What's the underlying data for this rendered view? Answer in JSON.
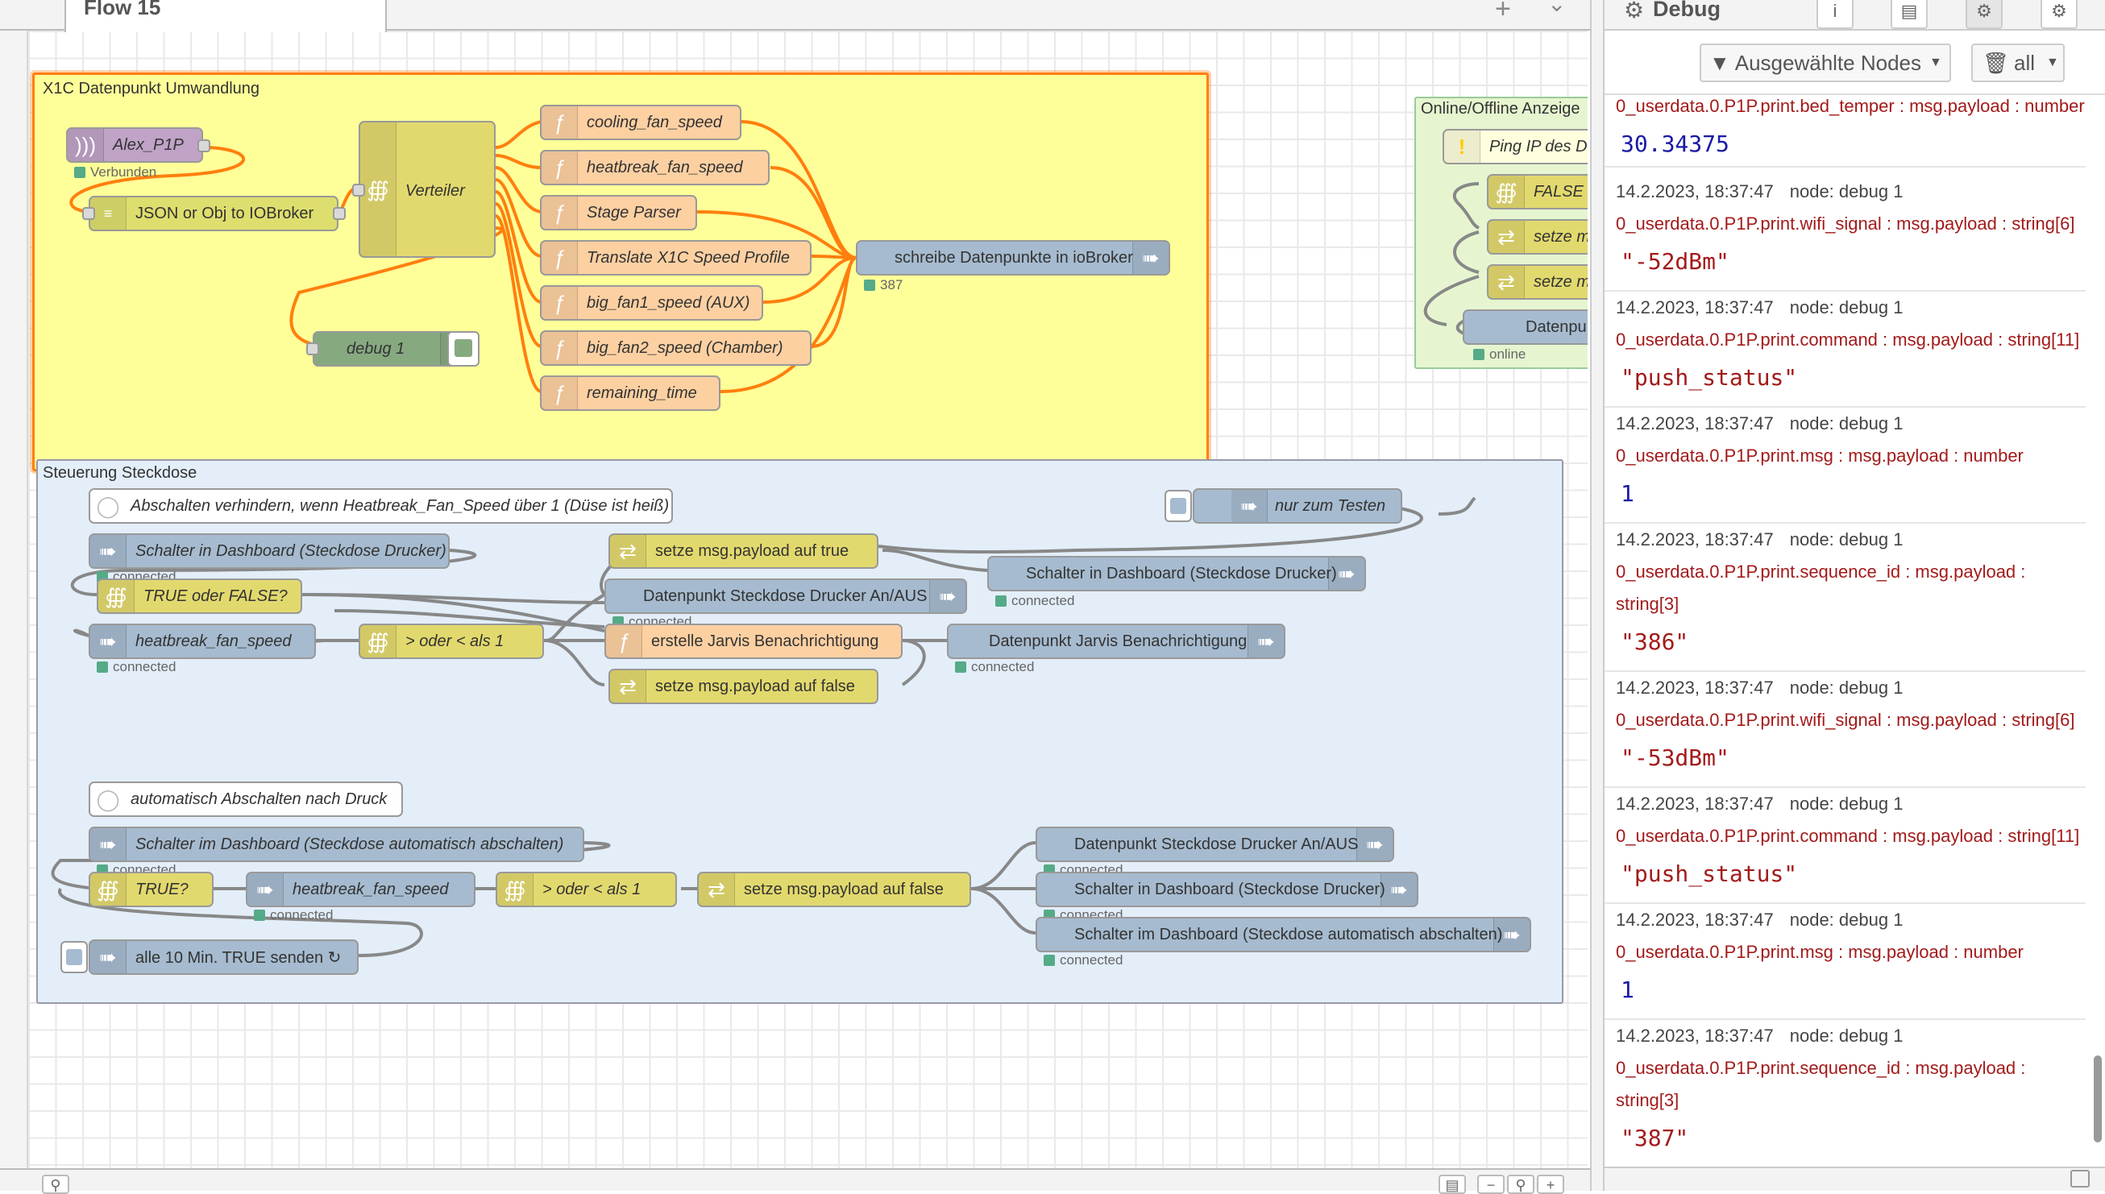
{
  "workspace": {
    "flow_tab": "Flow 15",
    "add_icon": "plus-icon",
    "menu_icon": "chevron-down-icon"
  },
  "colors": {
    "function": "#fdd0a2",
    "switch": "#e2d96e",
    "iobroker": "#a6bbcf",
    "debug": "#87a980",
    "mqtt": "#c0a3c7",
    "group_x1c": "#ffff99",
    "group_steuerung": "#e3f3ff",
    "group_online": "#e6f5d0",
    "wire_selected": "#ff7f0e",
    "status_connected": "#5a8"
  },
  "groups": {
    "x1c": "X1C Datenpunkt Umwandlung",
    "steuerung": "Steuerung Steckdose",
    "online": "Online/Offline Anzeige"
  },
  "nodes": {
    "alex": {
      "label": "Alex_P1P",
      "status": "Verbunden"
    },
    "json": {
      "label": "JSON or Obj to IOBroker"
    },
    "verteiler": {
      "label": "Verteiler"
    },
    "debug1": {
      "label": "debug 1"
    },
    "f1": {
      "label": "cooling_fan_speed"
    },
    "f2": {
      "label": "heatbreak_fan_speed"
    },
    "f3": {
      "label": "Stage Parser"
    },
    "f4": {
      "label": "Translate X1C Speed Profile"
    },
    "f5": {
      "label": "big_fan1_speed (AUX)"
    },
    "f6": {
      "label": "big_fan2_speed (Chamber)"
    },
    "f7": {
      "label": "remaining_time"
    },
    "schreibe": {
      "label": "schreibe Datenpunkte in ioBroker",
      "status": "387"
    },
    "ping": {
      "label": "Ping IP des Dr"
    },
    "false_sw": {
      "label": "FALSE o"
    },
    "setze1": {
      "label": "setze m"
    },
    "setze2": {
      "label": "setze m"
    },
    "dpw": {
      "label": "Datenpunkt W",
      "status": "online"
    },
    "cmt1": {
      "label": "Abschalten verhindern, wenn Heatbreak_Fan_Speed über 1 (Düse ist heiß)"
    },
    "inject_test": {
      "label": "nur zum Testen"
    },
    "schalter_in": {
      "label": "Schalter in Dashboard (Steckdose Drucker)",
      "status": "connected"
    },
    "true_false": {
      "label": "TRUE oder FALSE?"
    },
    "setze_true": {
      "label": "setze msg.payload auf true"
    },
    "schalter_out": {
      "label": "Schalter in Dashboard (Steckdose Drucker)",
      "status": "connected"
    },
    "dp_steck": {
      "label": "Datenpunkt Steckdose Drucker An/AUS",
      "status": "connected"
    },
    "hb_in": {
      "label": "heatbreak_fan_speed",
      "status": "connected"
    },
    "groesser": {
      "label": "> oder < als 1"
    },
    "jarvis_f": {
      "label": "erstelle Jarvis Benachrichtigung"
    },
    "jarvis_out": {
      "label": "Datenpunkt Jarvis Benachrichtigung",
      "status": "connected"
    },
    "setze_false": {
      "label": "setze msg.payload auf false"
    },
    "cmt2": {
      "label": "automatisch Abschalten nach Druck"
    },
    "auto_in": {
      "label": "Schalter im Dashboard (Steckdose automatisch abschalten)",
      "status": "connected"
    },
    "true_q": {
      "label": "TRUE?"
    },
    "hb_in2": {
      "label": "heatbreak_fan_speed",
      "status": "connected"
    },
    "groesser2": {
      "label": "> oder < als 1"
    },
    "setze_false2": {
      "label": "setze msg.payload auf false"
    },
    "dp_steck2": {
      "label": "Datenpunkt Steckdose Drucker An/AUS",
      "status": "connected"
    },
    "schalter_out2": {
      "label": "Schalter in Dashboard (Steckdose Drucker)",
      "status": "connected"
    },
    "auto_out": {
      "label": "Schalter im Dashboard (Steckdose automatisch abschalten)",
      "status": "connected"
    },
    "inject10": {
      "label": "alle 10 Min. TRUE senden ↻"
    }
  },
  "sidebar": {
    "title": "Debug",
    "filter_label": "Ausgewählte Nodes",
    "clear_label": "all",
    "messages": [
      {
        "topic": "0_userdata.0.P1P.print.bed_temper : msg.payload : number",
        "value": "30.34375",
        "kind": "num"
      },
      {
        "meta_time": "14.2.2023, 18:37:47",
        "meta_node": "node: debug 1",
        "topic": "0_userdata.0.P1P.print.wifi_signal : msg.payload : string[6]",
        "value": "\"-52dBm\"",
        "kind": "str"
      },
      {
        "meta_time": "14.2.2023, 18:37:47",
        "meta_node": "node: debug 1",
        "topic": "0_userdata.0.P1P.print.command : msg.payload : string[11]",
        "value": "\"push_status\"",
        "kind": "str"
      },
      {
        "meta_time": "14.2.2023, 18:37:47",
        "meta_node": "node: debug 1",
        "topic": "0_userdata.0.P1P.print.msg : msg.payload : number",
        "value": "1",
        "kind": "num"
      },
      {
        "meta_time": "14.2.2023, 18:37:47",
        "meta_node": "node: debug 1",
        "topic": "0_userdata.0.P1P.print.sequence_id : msg.payload : string[3]",
        "value": "\"386\"",
        "kind": "str"
      },
      {
        "meta_time": "14.2.2023, 18:37:47",
        "meta_node": "node: debug 1",
        "topic": "0_userdata.0.P1P.print.wifi_signal : msg.payload : string[6]",
        "value": "\"-53dBm\"",
        "kind": "str"
      },
      {
        "meta_time": "14.2.2023, 18:37:47",
        "meta_node": "node: debug 1",
        "topic": "0_userdata.0.P1P.print.command : msg.payload : string[11]",
        "value": "\"push_status\"",
        "kind": "str"
      },
      {
        "meta_time": "14.2.2023, 18:37:47",
        "meta_node": "node: debug 1",
        "topic": "0_userdata.0.P1P.print.msg : msg.payload : number",
        "value": "1",
        "kind": "num"
      },
      {
        "meta_time": "14.2.2023, 18:37:47",
        "meta_node": "node: debug 1",
        "topic": "0_userdata.0.P1P.print.sequence_id : msg.payload : string[3]",
        "value": "\"387\"",
        "kind": "str"
      }
    ]
  }
}
